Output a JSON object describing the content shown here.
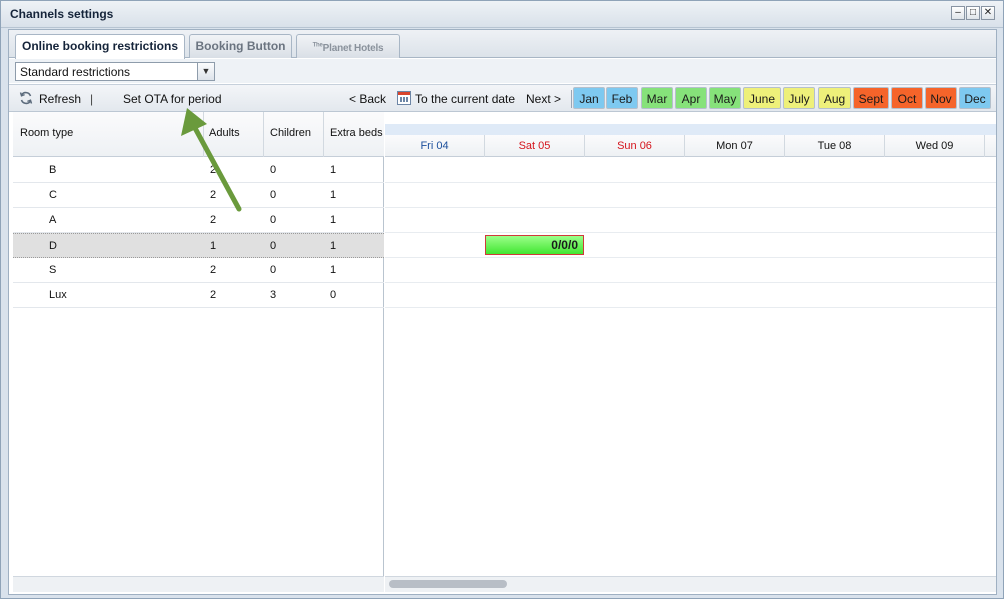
{
  "window": {
    "title": "Channels settings",
    "buttons": [
      "–",
      "□",
      "✕"
    ]
  },
  "tabs": [
    {
      "label": "Online booking restrictions",
      "active": true
    },
    {
      "label": "Booking Button",
      "active": false
    },
    {
      "label": "Planet Hotels",
      "prefix": "The",
      "active": false
    }
  ],
  "select": {
    "value": "Standard restrictions"
  },
  "toolbar": {
    "refresh": "Refresh",
    "separator": "|",
    "set_ota": "Set OTA for period",
    "back": "< Back",
    "current_date": "To the current date",
    "next": "Next >"
  },
  "months": [
    {
      "label": "Jan",
      "color": "#7ec9f0"
    },
    {
      "label": "Feb",
      "color": "#7ec9f0"
    },
    {
      "label": "Mar",
      "color": "#86e27a"
    },
    {
      "label": "Apr",
      "color": "#86e27a"
    },
    {
      "label": "May",
      "color": "#86e27a"
    },
    {
      "label": "June",
      "color": "#eef07a"
    },
    {
      "label": "July",
      "color": "#eef07a"
    },
    {
      "label": "Aug",
      "color": "#eef07a"
    },
    {
      "label": "Sept",
      "color": "#f5642a"
    },
    {
      "label": "Oct",
      "color": "#f5642a"
    },
    {
      "label": "Nov",
      "color": "#f5642a"
    },
    {
      "label": "Dec",
      "color": "#7ec9f0"
    }
  ],
  "columns": {
    "room_type": "Room type",
    "adults": "Adults",
    "children": "Children",
    "extra_beds": "Extra beds"
  },
  "rooms": [
    {
      "type": "B",
      "adults": "2",
      "children": "0",
      "extra": "1"
    },
    {
      "type": "C",
      "adults": "2",
      "children": "0",
      "extra": "1"
    },
    {
      "type": "A",
      "adults": "2",
      "children": "0",
      "extra": "1"
    },
    {
      "type": "D",
      "adults": "1",
      "children": "0",
      "extra": "1"
    },
    {
      "type": "S",
      "adults": "2",
      "children": "0",
      "extra": "1"
    },
    {
      "type": "Lux",
      "adults": "2",
      "children": "3",
      "extra": "0"
    }
  ],
  "days": [
    {
      "label": "Fri 04",
      "color": "#1c4f9c"
    },
    {
      "label": "Sat 05",
      "color": "#d4141c"
    },
    {
      "label": "Sun 06",
      "color": "#d4141c"
    },
    {
      "label": "Mon 07",
      "color": "#111111"
    },
    {
      "label": "Tue 08",
      "color": "#111111"
    },
    {
      "label": "Wed 09",
      "color": "#111111"
    }
  ],
  "ota_cell": {
    "text": "0/0/0"
  },
  "arrow_color": "#6a9a3c"
}
